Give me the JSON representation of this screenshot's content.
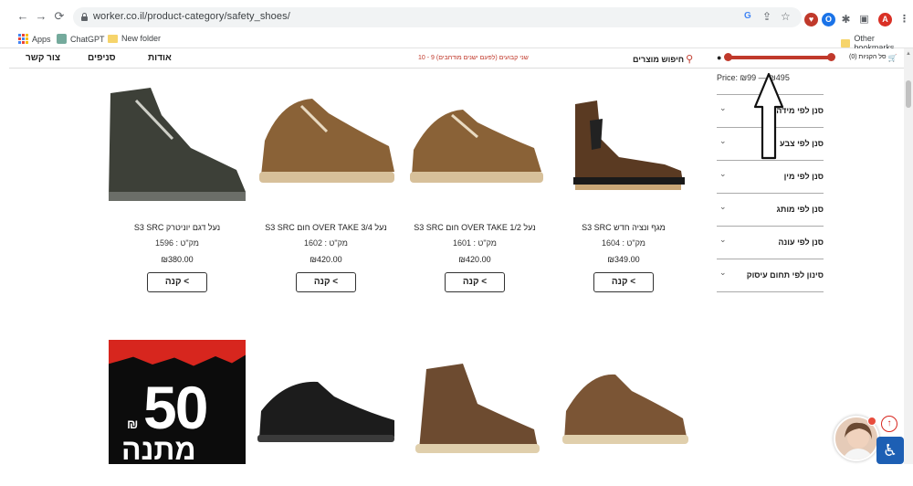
{
  "browser": {
    "url": "worker.co.il/product-category/safety_shoes/",
    "back": "←",
    "forward": "→",
    "reload": "⟳",
    "profile_initial": "A",
    "bookmarks": [
      "Apps",
      "ChatGPT",
      "New folder"
    ],
    "other_bookmarks": "Other bookmarks"
  },
  "header": {
    "contact": "צור קשר",
    "branches": "סניפים",
    "about": "אודות",
    "promo": "10 - 9 שני קבועים (לפעם ישנים מודחבים)",
    "search": "חיפוש מוצרים",
    "cart": "סל הקניות (0)"
  },
  "filters": {
    "price": "Price: ₪99 — ₪495",
    "items": [
      "סנן לפי מידה",
      "סנן לפי צבע",
      "סנן לפי מין",
      "סנן לפי מותג",
      "סנן לפי עונה",
      "סינון לפי תחום עיסוק"
    ]
  },
  "products": [
    {
      "name": "מגף ונציה חדש S3 SRC",
      "sku": "מק\"ט : 1604",
      "price": "₪349.00",
      "buy": "קנה <"
    },
    {
      "name": "נעל 1/2 OVER TAKE חום S3 SRC",
      "sku": "מק\"ט : 1601",
      "price": "₪420.00",
      "buy": "קנה <"
    },
    {
      "name": "נעל 3/4 OVER TAKE חום S3 SRC",
      "sku": "מק\"ט : 1602",
      "price": "₪420.00",
      "buy": "קנה <"
    },
    {
      "name": "נעל דגם יוניטרק S3 SRC",
      "sku": "מק\"ט : 1596",
      "price": "₪380.00",
      "buy": "קנה <"
    }
  ],
  "promo_banner": {
    "number": "50",
    "currency": "₪",
    "word": "מתנה"
  },
  "widgets": {
    "back_to_top": "↑",
    "accessibility": "♿"
  }
}
